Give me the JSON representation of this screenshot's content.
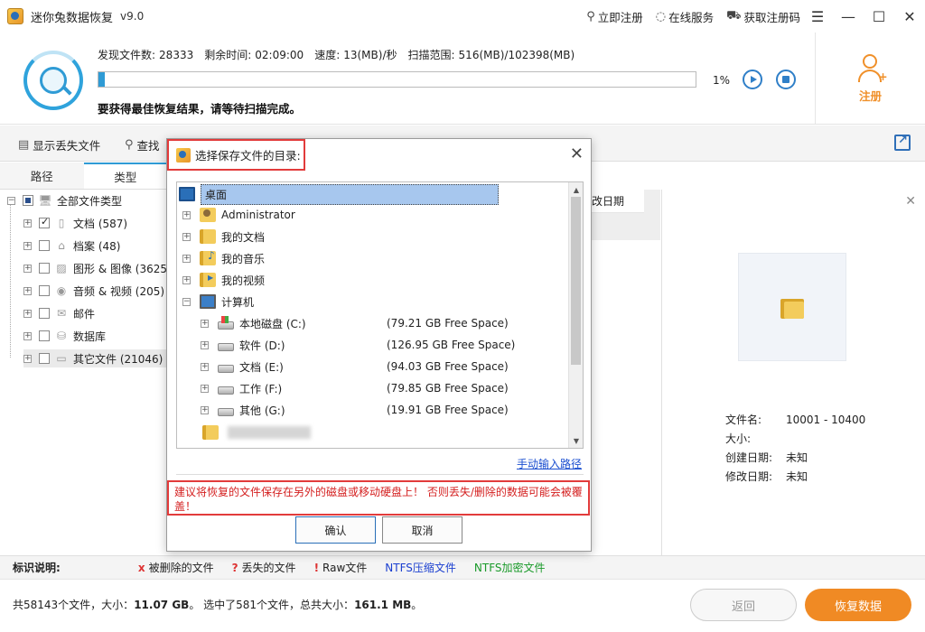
{
  "app": {
    "title": "迷你兔数据恢复",
    "version": "v9.0"
  },
  "title_links": {
    "register": "立即注册",
    "online_service": "在线服务",
    "get_code": "获取注册码"
  },
  "scan": {
    "found_label": "发现文件数:",
    "found_value": "28333",
    "remaining_label": "剩余时间:",
    "remaining_value": "02:09:00",
    "speed_label": "速度:",
    "speed_value": "13(MB)/秒",
    "range_label": "扫描范围:",
    "range_value": "516(MB)/102398(MB)",
    "progress": 0.01,
    "progress_text": "1%",
    "hint": "要获得最佳恢复结果，请等待扫描完成。"
  },
  "register_label": "注册",
  "toolbar": {
    "show_lost": "显示丢失文件",
    "find": "查找"
  },
  "left_tabs": [
    "路径",
    "类型"
  ],
  "tree": {
    "root": "全部文件类型",
    "items": [
      {
        "label": "文档 (587)",
        "checked": true
      },
      {
        "label": "档案 (48)",
        "checked": false
      },
      {
        "label": "图形 & 图像 (3625",
        "checked": false
      },
      {
        "label": "音频 & 视频 (205)",
        "checked": false
      },
      {
        "label": "邮件",
        "checked": false
      },
      {
        "label": "数据库",
        "checked": false
      },
      {
        "label": "其它文件 (21046)",
        "checked": false
      }
    ]
  },
  "column_header": "改日期",
  "preview": {
    "file_name_label": "文件名:",
    "file_name_value": "10001 - 10400",
    "size_label": "大小:",
    "size_value": "",
    "created_label": "创建日期:",
    "created_value": "未知",
    "modified_label": "修改日期:",
    "modified_value": "未知"
  },
  "legend": {
    "title": "标识说明:",
    "deleted": "被删除的文件",
    "lost": "丢失的文件",
    "raw": "Raw文件",
    "ntfs_compressed": "NTFS压缩文件",
    "ntfs_encrypted": "NTFS加密文件",
    "colors": {
      "deleted_mark": "#d33333",
      "compressed": "#1b3fd0",
      "encrypted": "#1a9a2a"
    }
  },
  "footer": {
    "summary_prefix": "共58143个文件，大小：",
    "summary_size": "11.07 GB",
    "summary_mid": "。 选中了581个文件，总共大小：",
    "summary_sel": "161.1 MB",
    "summary_end": "。",
    "back": "返回",
    "recover": "恢复数据"
  },
  "dialog": {
    "title": "选择保存文件的目录:",
    "desktop": "桌面",
    "items": [
      {
        "label": "Administrator",
        "icon": "user-folder"
      },
      {
        "label": "我的文档",
        "icon": "folder"
      },
      {
        "label": "我的音乐",
        "icon": "music-folder"
      },
      {
        "label": "我的视频",
        "icon": "video-folder"
      },
      {
        "label": "计算机",
        "icon": "computer"
      }
    ],
    "drives": [
      {
        "label": "本地磁盘 (C:)",
        "free": "(79.21 GB Free Space)"
      },
      {
        "label": "软件 (D:)",
        "free": "(126.95 GB Free Space)"
      },
      {
        "label": "文档 (E:)",
        "free": "(94.03 GB Free Space)"
      },
      {
        "label": "工作 (F:)",
        "free": "(79.85 GB Free Space)"
      },
      {
        "label": "其他 (G:)",
        "free": "(19.91 GB Free Space)"
      }
    ],
    "manual_path": "手动输入路径",
    "warning": "建议将恢复的文件保存在另外的磁盘或移动硬盘上！ 否则丢失/删除的数据可能会被覆盖！",
    "ok": "确认",
    "cancel": "取消"
  }
}
